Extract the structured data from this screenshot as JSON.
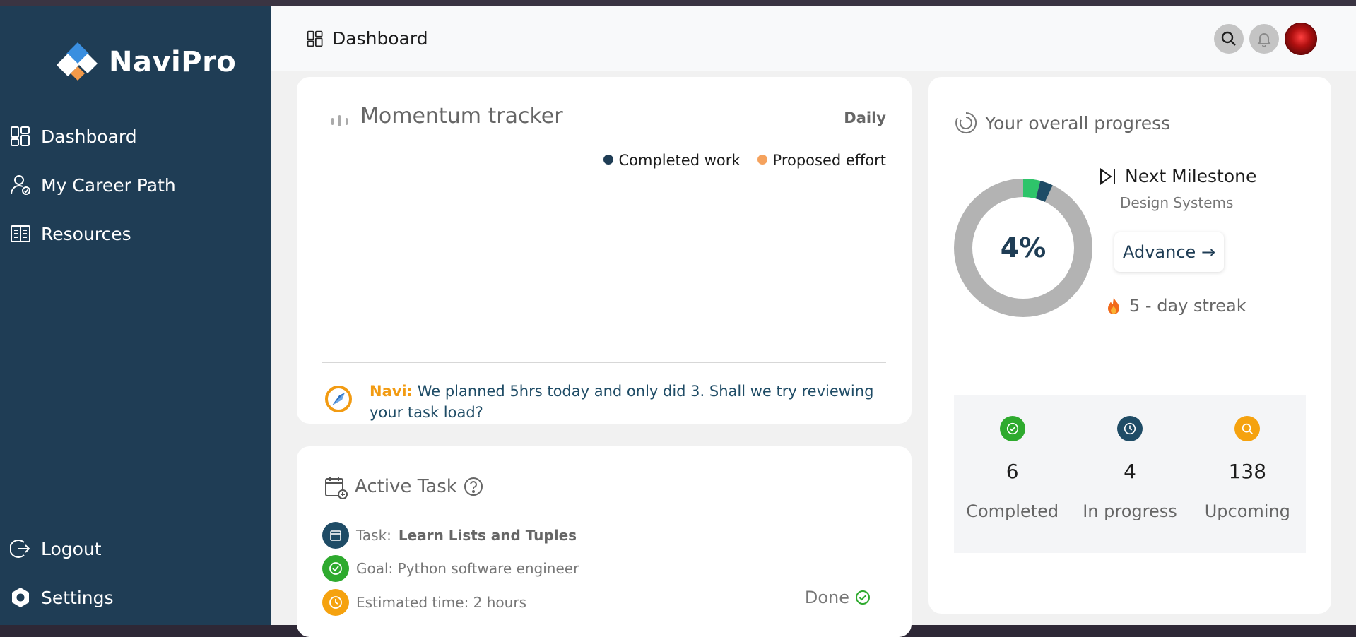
{
  "app": {
    "name": "NaviPro"
  },
  "sidebar": {
    "items": [
      {
        "label": "Dashboard",
        "icon": "dashboard-icon"
      },
      {
        "label": "My Career Path",
        "icon": "career-path-icon"
      },
      {
        "label": "Resources",
        "icon": "book-icon"
      }
    ],
    "bottom": [
      {
        "label": "Logout",
        "icon": "logout-icon"
      },
      {
        "label": "Settings",
        "icon": "gear-icon"
      }
    ]
  },
  "header": {
    "title": "Dashboard"
  },
  "momentum": {
    "title": "Momentum tracker",
    "period": "Daily",
    "legend": [
      {
        "label": "Completed work",
        "color": "#1f3d55"
      },
      {
        "label": "Proposed effort",
        "color": "#f5a25d"
      }
    ],
    "navi_name": "Navi:",
    "navi_message": "We planned 5hrs today and only did 3. Shall we try reviewing your task load?"
  },
  "active_task": {
    "title": "Active Task",
    "task_prefix": "Task:",
    "task_name": "Learn Lists and Tuples",
    "goal": "Goal: Python software engineer",
    "estimate": "Estimated time: 2 hours",
    "status": "Done"
  },
  "progress": {
    "title": "Your overall progress",
    "percent_label": "4%",
    "percent": 4,
    "milestone_title": "Next Milestone",
    "milestone_name": "Design Systems",
    "advance_label": "Advance →",
    "streak": "5 - day streak",
    "stats": [
      {
        "value": "6",
        "label": "Completed",
        "color": "#2eaa2e",
        "icon": "check-icon"
      },
      {
        "value": "4",
        "label": "In progress",
        "color": "#1f4c66",
        "icon": "clock-icon"
      },
      {
        "value": "138",
        "label": "Upcoming",
        "color": "#f5a20f",
        "icon": "search-icon"
      }
    ]
  },
  "colors": {
    "sidebar": "#1f3d55",
    "accent": "#f29b12",
    "success": "#2eaa2e"
  }
}
